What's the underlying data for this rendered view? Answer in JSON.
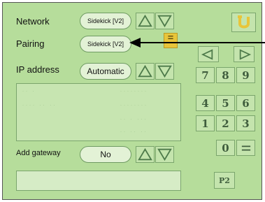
{
  "labels": {
    "network": "Network",
    "pairing": "Pairing",
    "ip_address": "IP address",
    "add_gateway": "Add gateway"
  },
  "values": {
    "network": "Sidekick [V2]",
    "pairing": "Sidekick [V2]",
    "ip_address": "Automatic",
    "add_gateway": "No"
  },
  "keypad": {
    "row1": [
      "7",
      "8",
      "9"
    ],
    "row2": [
      "4",
      "5",
      "6"
    ],
    "row3": [
      "1",
      "2",
      "3"
    ],
    "zero": "0",
    "p2": "P2"
  },
  "icons": {
    "up": "triangle-up-icon",
    "down": "triangle-down-icon",
    "left": "arrow-left-icon",
    "right": "arrow-right-icon",
    "back": "return-icon",
    "pointer": "annotation-arrow-icon",
    "edit": "edit-icon"
  },
  "colors": {
    "background": "#b6dd9b",
    "field": "#e3f2d6",
    "key_text": "#3f5d3d",
    "accent_yellow": "#e8c53a"
  }
}
